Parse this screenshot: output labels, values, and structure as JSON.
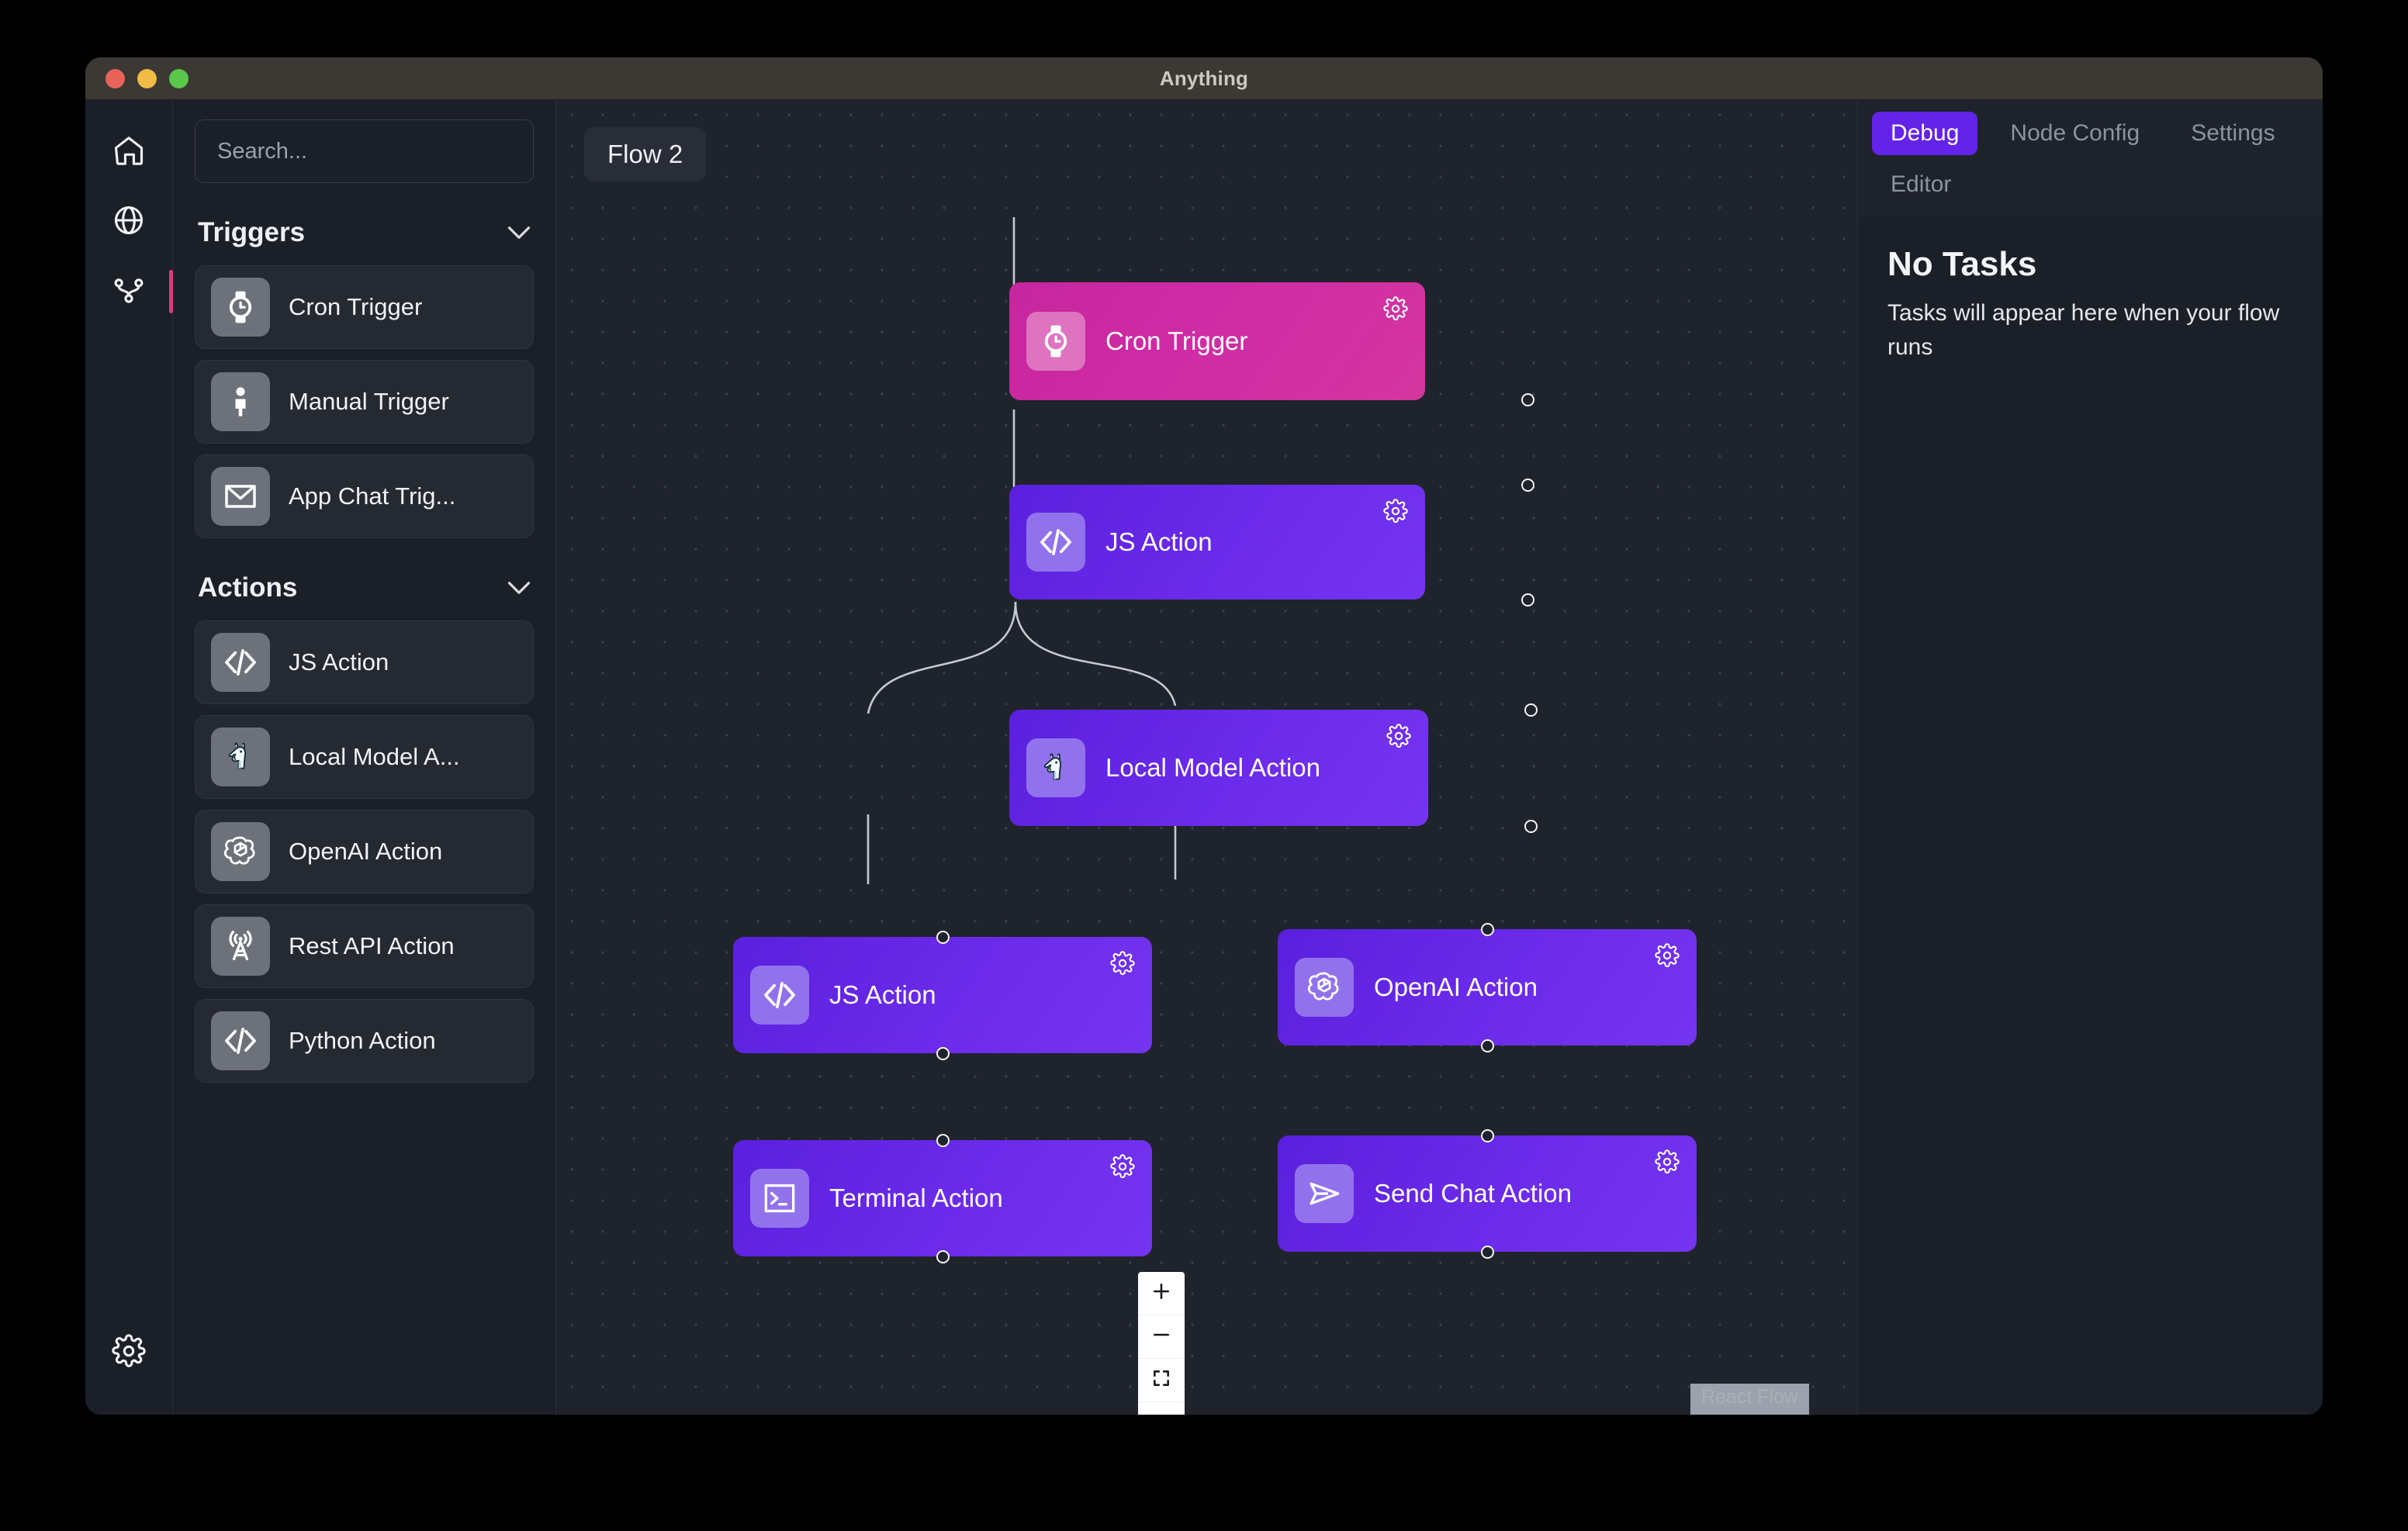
{
  "window": {
    "title": "Anything",
    "traffic_lights": [
      "close",
      "minimize",
      "maximize"
    ]
  },
  "icon_rail": {
    "items": [
      {
        "name": "home",
        "icon": "home-icon",
        "active": false
      },
      {
        "name": "globe",
        "icon": "globe-icon",
        "active": false
      },
      {
        "name": "flows",
        "icon": "flow-branch-icon",
        "active": true
      }
    ],
    "bottom": {
      "name": "settings",
      "icon": "gear-icon"
    }
  },
  "left_panel": {
    "search": {
      "placeholder": "Search...",
      "value": ""
    },
    "sections": [
      {
        "title": "Triggers",
        "expanded": true,
        "items": [
          {
            "label": "Cron Trigger",
            "icon": "watch-clock-icon"
          },
          {
            "label": "Manual Trigger",
            "icon": "person-icon"
          },
          {
            "label": "App Chat Trig...",
            "icon": "envelope-icon"
          }
        ]
      },
      {
        "title": "Actions",
        "expanded": true,
        "items": [
          {
            "label": "JS Action",
            "icon": "code-brackets-icon"
          },
          {
            "label": "Local Model A...",
            "icon": "llama-icon"
          },
          {
            "label": "OpenAI Action",
            "icon": "openai-icon"
          },
          {
            "label": "Rest API Action",
            "icon": "broadcast-tower-icon"
          },
          {
            "label": "Python Action",
            "icon": "code-brackets-icon"
          }
        ]
      }
    ]
  },
  "canvas": {
    "flow_badge": "Flow 2",
    "watermark": "React Flow",
    "zoom_controls": [
      {
        "name": "zoom-in",
        "icon": "plus-icon"
      },
      {
        "name": "zoom-out",
        "icon": "minus-icon"
      },
      {
        "name": "fit-view",
        "icon": "fit-view-icon"
      },
      {
        "name": "toggle-interactivity",
        "icon": "unlock-icon"
      }
    ],
    "nodes": [
      {
        "id": "cron",
        "label": "Cron Trigger",
        "icon": "watch-clock-icon",
        "color": "pink",
        "accent": "#c6269e"
      },
      {
        "id": "js1",
        "label": "JS Action",
        "icon": "code-brackets-icon",
        "color": "purple",
        "accent": "#6c2bea"
      },
      {
        "id": "local",
        "label": "Local Model Action",
        "icon": "llama-icon",
        "color": "purple",
        "accent": "#6c2bea"
      },
      {
        "id": "js2",
        "label": "JS Action",
        "icon": "code-brackets-icon",
        "color": "purple",
        "accent": "#6c2bea"
      },
      {
        "id": "openai",
        "label": "OpenAI Action",
        "icon": "openai-icon",
        "color": "purple",
        "accent": "#6c2bea"
      },
      {
        "id": "terminal",
        "label": "Terminal Action",
        "icon": "terminal-icon",
        "color": "purple",
        "accent": "#6c2bea"
      },
      {
        "id": "sendchat",
        "label": "Send Chat Action",
        "icon": "paper-plane-icon",
        "color": "purple",
        "accent": "#6c2bea"
      }
    ],
    "edges": [
      {
        "from": "cron",
        "to": "js1"
      },
      {
        "from": "js1",
        "to": "local"
      },
      {
        "from": "local",
        "to": "js2"
      },
      {
        "from": "local",
        "to": "openai"
      },
      {
        "from": "js2",
        "to": "terminal"
      },
      {
        "from": "openai",
        "to": "sendchat"
      }
    ]
  },
  "right_panel": {
    "tabs": [
      {
        "label": "Debug",
        "active": true
      },
      {
        "label": "Node Config",
        "active": false
      },
      {
        "label": "Settings",
        "active": false
      },
      {
        "label": "Editor",
        "active": false
      }
    ],
    "empty_state": {
      "heading": "No Tasks",
      "subtext": "Tasks will appear here when your flow runs"
    }
  },
  "colors": {
    "accent_purple": "#6423e8",
    "accent_pink": "#e3397f",
    "node_purple": "#6c2bea",
    "node_pink": "#c6269e",
    "panel_bg": "#1b1f28",
    "canvas_bg": "#1f232c"
  }
}
